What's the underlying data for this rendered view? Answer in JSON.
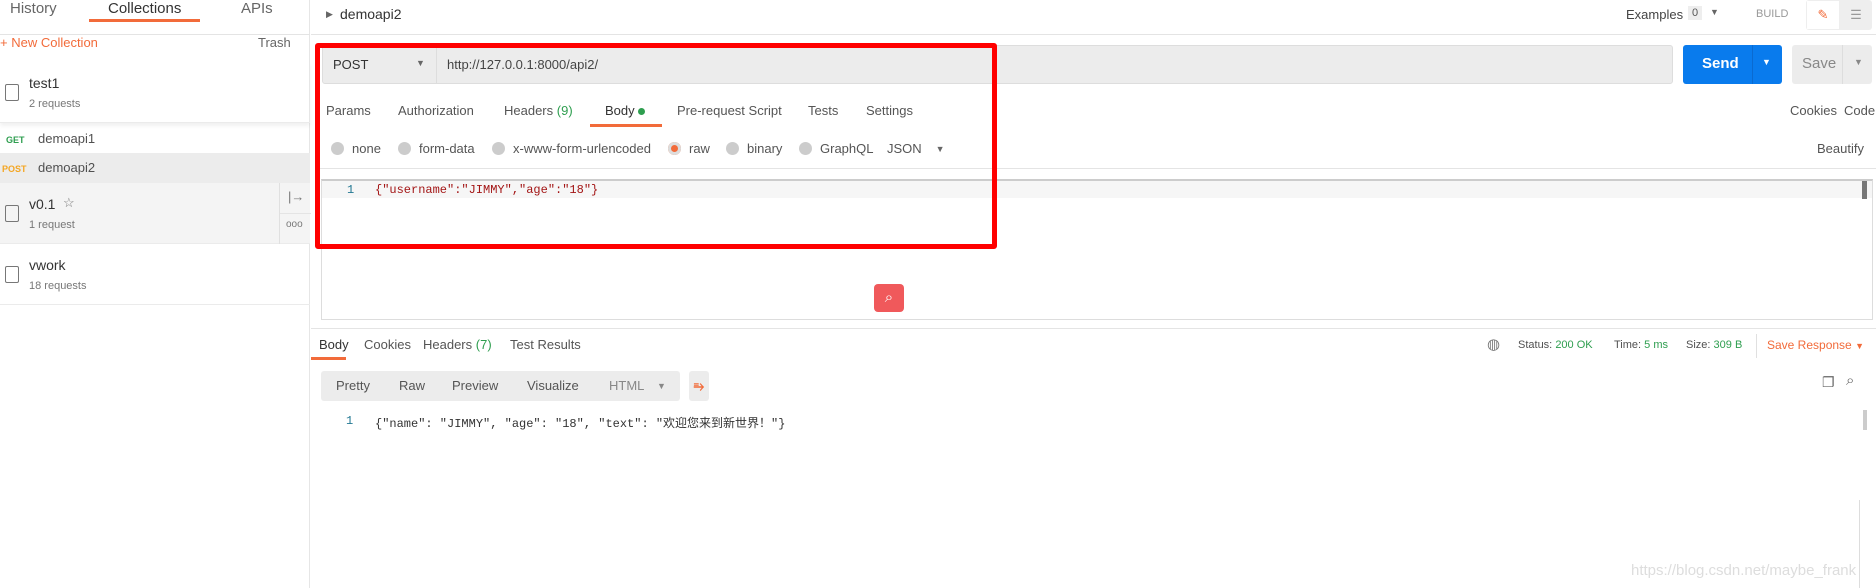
{
  "sidebar": {
    "tabs": [
      "History",
      "Collections",
      "APIs"
    ],
    "active_tab": "Collections",
    "new_collection": "+ New Collection",
    "trash": "Trash",
    "collections": [
      {
        "name": "test1",
        "count": "2 requests"
      },
      {
        "name": "v0.1",
        "count": "1 request",
        "star": "☆"
      },
      {
        "name": "vwork",
        "count": "18 requests"
      }
    ],
    "requests": [
      {
        "method": "GET",
        "name": "demoapi1",
        "color": "#2e9e4f"
      },
      {
        "method": "POST",
        "name": "demoapi2",
        "color": "#f4a623"
      }
    ]
  },
  "header": {
    "title": "demoapi2",
    "examples_label": "Examples",
    "examples_count": "0",
    "build_label": "BUILD"
  },
  "request": {
    "method": "POST",
    "url": "http://127.0.0.1:8000/api2/",
    "send": "Send",
    "save": "Save",
    "tabs": {
      "params": "Params",
      "authorization": "Authorization",
      "headers": "Headers",
      "headers_count": "(9)",
      "body": "Body",
      "prerequest": "Pre-request Script",
      "tests": "Tests",
      "settings": "Settings"
    },
    "cookies": "Cookies",
    "code": "Code",
    "body_types": [
      "none",
      "form-data",
      "x-www-form-urlencoded",
      "raw",
      "binary",
      "GraphQL"
    ],
    "selected_body_type": "raw",
    "format": "JSON",
    "beautify": "Beautify",
    "line_number": "1",
    "body_text": "{\"username\":\"JIMMY\",\"age\":\"18\"}"
  },
  "response": {
    "tabs": {
      "body": "Body",
      "cookies": "Cookies",
      "headers": "Headers",
      "headers_count": "(7)",
      "test_results": "Test Results"
    },
    "status_label": "Status:",
    "status": "200 OK",
    "time_label": "Time:",
    "time": "5 ms",
    "size_label": "Size:",
    "size": "309 B",
    "save_response": "Save Response",
    "views": [
      "Pretty",
      "Raw",
      "Preview",
      "Visualize"
    ],
    "format": "HTML",
    "line_number": "1",
    "body_text": "{\"name\": \"JIMMY\", \"age\": \"18\", \"text\": \"欢迎您来到新世界！\"}"
  },
  "watermark": "https://blog.csdn.net/maybe_frank",
  "colors": {
    "accent": "#f26b3a",
    "send": "#097bed",
    "highlight": "#ff0000",
    "success": "#2e9e4f"
  }
}
